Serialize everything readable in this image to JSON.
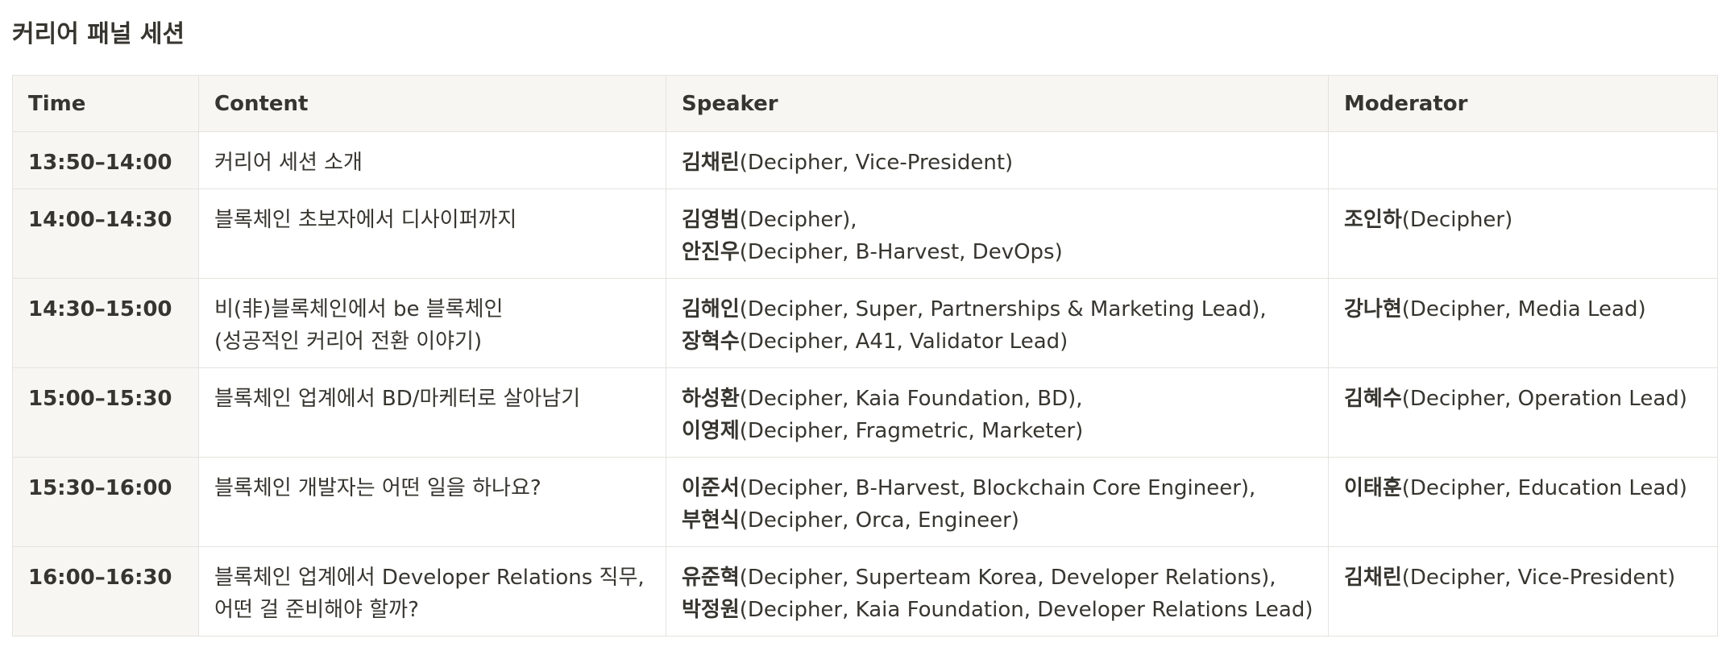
{
  "title": "커리어 패널 세션",
  "headers": {
    "time": "Time",
    "content": "Content",
    "speaker": "Speaker",
    "moderator": "Moderator"
  },
  "rows": [
    {
      "time": "13:50–14:00",
      "content": [
        "커리어 세션 소개"
      ],
      "speakers": [
        {
          "name": "김채린",
          "detail": "(Decipher, Vice-President)"
        }
      ],
      "moderator": {
        "name": "",
        "detail": ""
      }
    },
    {
      "time": "14:00–14:30",
      "content": [
        "블록체인 초보자에서 디사이퍼까지"
      ],
      "speakers": [
        {
          "name": "김영범",
          "detail": "(Decipher),"
        },
        {
          "name": "안진우",
          "detail": "(Decipher, B-Harvest, DevOps)"
        }
      ],
      "moderator": {
        "name": "조인하",
        "detail": "(Decipher)"
      }
    },
    {
      "time": "14:30–15:00",
      "content": [
        "비(非)블록체인에서 be 블록체인",
        "(성공적인 커리어 전환 이야기)"
      ],
      "speakers": [
        {
          "name": "김해인",
          "detail": "(Decipher, Super, Partnerships & Marketing Lead),"
        },
        {
          "name": "장혁수",
          "detail": "(Decipher, A41, Validator Lead)"
        }
      ],
      "moderator": {
        "name": "강나현",
        "detail": "(Decipher, Media Lead)"
      }
    },
    {
      "time": "15:00–15:30",
      "content": [
        "블록체인 업계에서 BD/마케터로 살아남기"
      ],
      "speakers": [
        {
          "name": "하성환",
          "detail": "(Decipher, Kaia Foundation, BD),"
        },
        {
          "name": "이영제",
          "detail": "(Decipher, Fragmetric, Marketer)"
        }
      ],
      "moderator": {
        "name": "김혜수",
        "detail": "(Decipher, Operation Lead)"
      }
    },
    {
      "time": "15:30–16:00",
      "content": [
        "블록체인 개발자는 어떤 일을 하나요?"
      ],
      "speakers": [
        {
          "name": "이준서",
          "detail": "(Decipher, B-Harvest, Blockchain Core Engineer),"
        },
        {
          "name": "부현식",
          "detail": "(Decipher, Orca, Engineer)"
        }
      ],
      "moderator": {
        "name": "이태훈",
        "detail": "(Decipher, Education Lead)"
      }
    },
    {
      "time": "16:00–16:30",
      "content": [
        "블록체인 업계에서 Developer Relations 직무,",
        "어떤 걸 준비해야 할까?"
      ],
      "speakers": [
        {
          "name": "유준혁",
          "detail": "(Decipher, Superteam Korea, Developer Relations),"
        },
        {
          "name": "박정원",
          "detail": "(Decipher, Kaia Foundation, Developer Relations Lead)"
        }
      ],
      "moderator": {
        "name": "김채린",
        "detail": "(Decipher, Vice-President)"
      }
    }
  ]
}
